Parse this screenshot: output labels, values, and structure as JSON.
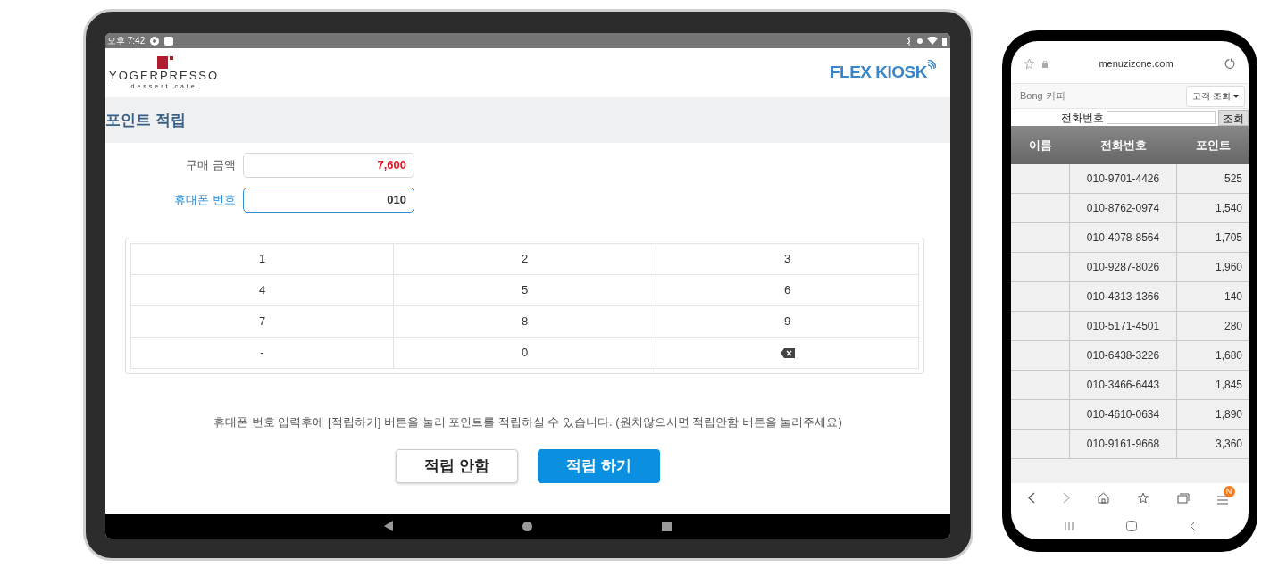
{
  "tablet": {
    "status_bar": {
      "time": "오후 7:42"
    },
    "header": {
      "brand": "YOGERPRESSO",
      "brand_sub": "dessert cafe",
      "kiosk_logo": "FLEX KIOSK"
    },
    "page_title": "포인트 적립",
    "fields": [
      {
        "label": "구매 금액",
        "value": "7,600",
        "focused": false,
        "kind": "amount"
      },
      {
        "label": "휴대폰 번호",
        "value": "010",
        "focused": true,
        "kind": "phone"
      }
    ],
    "keypad": [
      {
        "kind": "key",
        "label": "1"
      },
      {
        "kind": "key",
        "label": "2"
      },
      {
        "kind": "key",
        "label": "3"
      },
      {
        "kind": "key",
        "label": "4"
      },
      {
        "kind": "key",
        "label": "5"
      },
      {
        "kind": "key",
        "label": "6"
      },
      {
        "kind": "key",
        "label": "7"
      },
      {
        "kind": "key",
        "label": "8"
      },
      {
        "kind": "key",
        "label": "9"
      },
      {
        "kind": "key",
        "label": "-"
      },
      {
        "kind": "key",
        "label": "0"
      },
      {
        "kind": "backspace"
      }
    ],
    "instruction": "휴대폰 번호 입력후에 [적립하기] 버튼을 눌러 포인트를 적립하실 수 있습니다. (원치않으시면 적립안함 버튼을 눌러주세요)",
    "buttons": [
      {
        "label": "적립 안함",
        "kind": "secondary"
      },
      {
        "label": "적립 하기",
        "kind": "primary"
      }
    ]
  },
  "phone": {
    "url": "menuzizone.com",
    "store": "Bong 커피",
    "menu_button": "고객 조회",
    "search": {
      "label": "전화번호",
      "button": "조회"
    },
    "table": {
      "columns": [
        "이름",
        "전화번호",
        "포인트"
      ],
      "rows": [
        {
          "name": "",
          "phone": "010-9701-4426",
          "points": "525"
        },
        {
          "name": "",
          "phone": "010-8762-0974",
          "points": "1,540"
        },
        {
          "name": "",
          "phone": "010-4078-8564",
          "points": "1,705"
        },
        {
          "name": "",
          "phone": "010-9287-8026",
          "points": "1,960"
        },
        {
          "name": "",
          "phone": "010-4313-1366",
          "points": "140"
        },
        {
          "name": "",
          "phone": "010-5171-4501",
          "points": "280"
        },
        {
          "name": "",
          "phone": "010-6438-3226",
          "points": "1,680"
        },
        {
          "name": "",
          "phone": "010-3466-6443",
          "points": "1,845"
        },
        {
          "name": "",
          "phone": "010-4610-0634",
          "points": "1,890"
        },
        {
          "name": "",
          "phone": "010-9161-9668",
          "points": "3,360"
        }
      ]
    },
    "menu_badge": "N"
  }
}
